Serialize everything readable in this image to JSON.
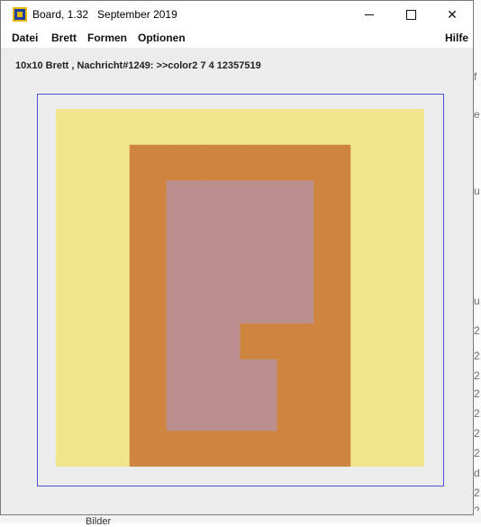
{
  "window": {
    "title": "Board, 1.32   September 2019",
    "controls": {
      "minimize": "minimize",
      "maximize": "maximize",
      "close": "✕"
    }
  },
  "menu": {
    "items": [
      "Datei",
      "Brett",
      "Formen",
      "Optionen"
    ],
    "help": "Hilfe"
  },
  "status": {
    "info": "10x10 Brett , Nachricht#1249: >>color2 7 4 12357519"
  },
  "board": {
    "rows": 10,
    "cols": 10,
    "palette": {
      "Y": "#f0e48c",
      "O": "#cd853f",
      "P": "#bc8f8f"
    },
    "grid": [
      "YYYYYYYYYY",
      "YYOOOOOOYY",
      "YYOPPPPOYY",
      "YYOPPPPOYY",
      "YYOPPPPOYY",
      "YYOPPPPOYY",
      "YYOPPOOOYY",
      "YYOPPPOOYY",
      "YYOPPPOOYY",
      "YYOOOOOOYY"
    ]
  },
  "background": {
    "right_fragments": [
      "f",
      "e",
      "u",
      "u",
      "2",
      "2",
      "2",
      "2",
      "2",
      "2",
      "2",
      "d",
      "2",
      "2"
    ],
    "bottom_fragment": "Bilder"
  }
}
